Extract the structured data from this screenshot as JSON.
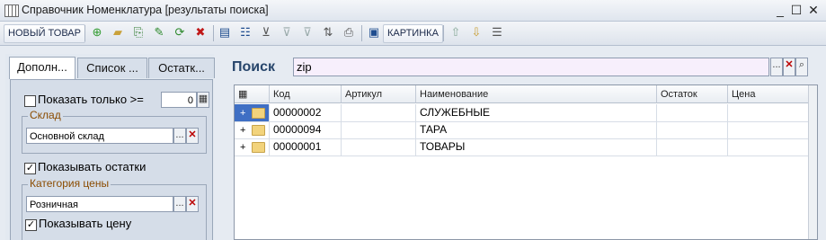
{
  "window": {
    "title": "Справочник Номенклатура [результаты поиска]",
    "controls": [
      "_",
      "☐",
      "✕"
    ]
  },
  "toolbar": {
    "new_item_label": "НОВЫЙ ТОВАР",
    "picture_label": "КАРТИНКА"
  },
  "left_panel": {
    "tabs": [
      {
        "label": "Дополн..."
      },
      {
        "label": "Список ..."
      },
      {
        "label": "Остатк..."
      }
    ],
    "show_only_label": "Показать только >=",
    "show_only_value": "0",
    "warehouse_legend": "Склад",
    "warehouse_value": "Основной склад",
    "show_stock_label": "Показывать остатки",
    "price_category_legend": "Категория цены",
    "price_category_value": "Розничная",
    "show_price_label": "Показывать цену",
    "ellipsis": "...",
    "clear": "✕"
  },
  "search": {
    "label": "Поиск",
    "value": "zip",
    "ellipsis": "...",
    "clear": "✕",
    "go": "🔍"
  },
  "grid": {
    "columns": [
      "Код",
      "Артикул",
      "Наименование",
      "Остаток",
      "Цена"
    ],
    "rows": [
      {
        "code": "00000002",
        "article": "",
        "name": "СЛУЖЕБНЫЕ",
        "stock": "",
        "price": ""
      },
      {
        "code": "00000094",
        "article": "",
        "name": "ТАРА",
        "stock": "",
        "price": ""
      },
      {
        "code": "00000001",
        "article": "",
        "name": "ТОВАРЫ",
        "stock": "",
        "price": ""
      }
    ]
  }
}
